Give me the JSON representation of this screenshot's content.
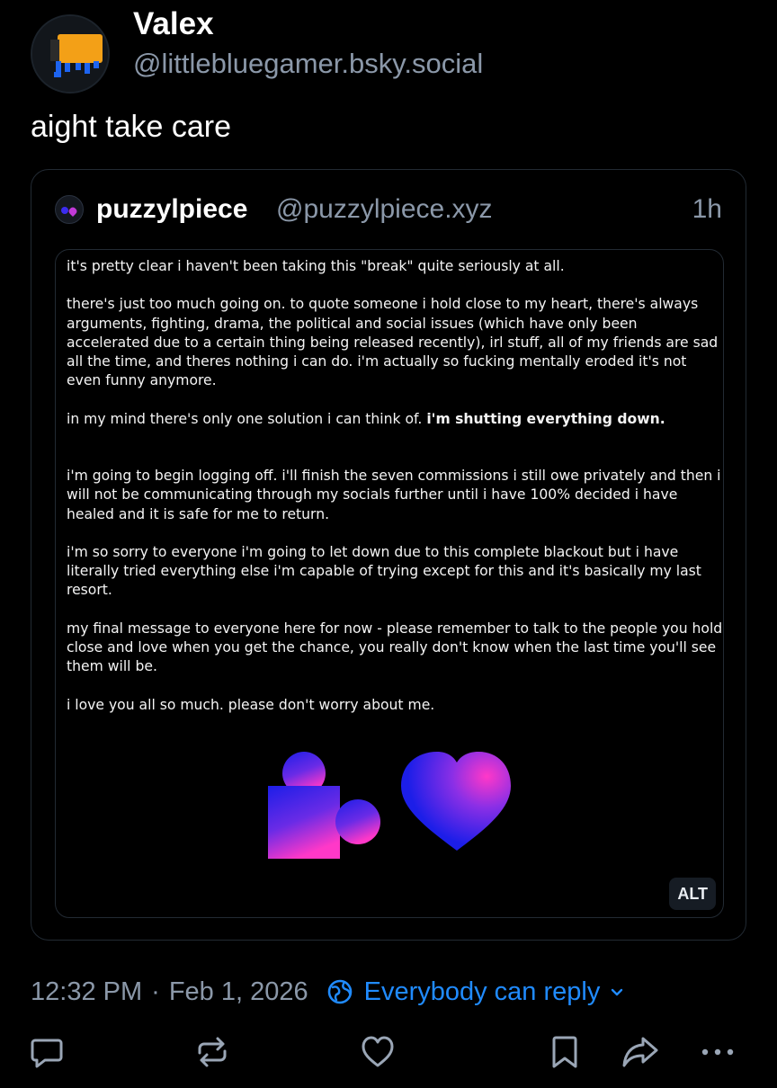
{
  "post": {
    "author_name": "Valex",
    "author_handle": "@littlebluegamer.bsky.social",
    "text": "aight take care",
    "time": "12:32 PM",
    "separator": "·",
    "date": "Feb 1, 2026",
    "reply_setting": "Everybody can reply"
  },
  "quote": {
    "author_name": "puzzylpiece",
    "author_handle": "@puzzylpiece.xyz",
    "age": "1h",
    "image_alt_badge": "ALT",
    "image_text": {
      "p1": "it's pretty clear i haven't been taking this \"break\" quite seriously at all.",
      "p2": "there's just too much going on. to quote someone i hold close to my heart, there's always arguments, fighting, drama, the political and social issues (which have only been accelerated due to a certain thing being released recently), irl stuff, all of my friends are sad all the time, and theres nothing i can do. i'm actually so fucking mentally eroded it's not even funny anymore.",
      "p3_lead": "in my mind there's only one solution i can think of. ",
      "p3_bold": "i'm shutting everything down.",
      "p4": "i'm going to begin logging off. i'll finish the seven commissions i still owe privately and then i will not be communicating through my socials further until i have 100% decided i have healed and it is safe for me to return.",
      "p5": "i'm so sorry to everyone i'm going to let down due to this complete blackout but i have literally tried everything else i'm capable of trying except for this and it's basically my last resort.",
      "p6": "my final message to everyone here for now - please remember to talk to the people you hold close and love when you get the chance, you really don't know when the last time you'll see them will be.",
      "p7": "i love you all so much.  please don't worry about me."
    }
  },
  "icons": {
    "reply": "reply-icon",
    "repost": "repost-icon",
    "like": "heart-icon",
    "bookmark": "bookmark-icon",
    "share": "share-icon",
    "more": "more-icon",
    "reply_setting": "earth-icon",
    "chevron": "chevron-down-icon"
  },
  "colors": {
    "background": "#000000",
    "muted_text": "#8b98a9",
    "accent": "#208bfe",
    "border": "#222a33",
    "icon": "#9aa6b6",
    "art_gradient_top": "#1c1ee8",
    "art_gradient_bottom": "#ff38c8"
  }
}
